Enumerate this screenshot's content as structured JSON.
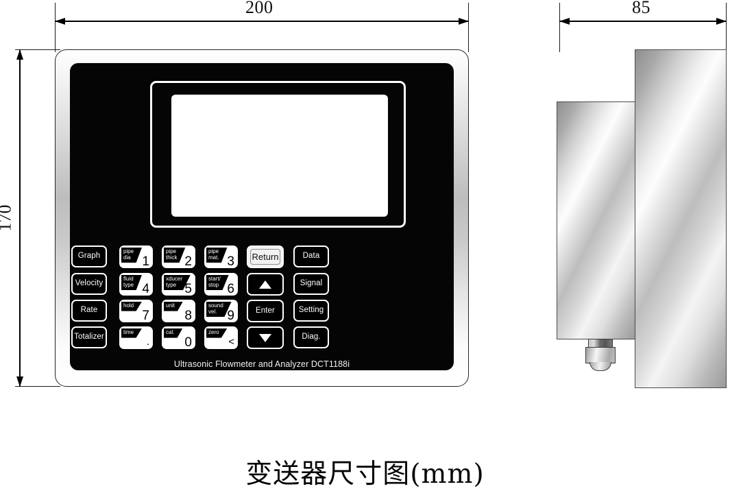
{
  "diagram": {
    "caption": "变送器尺寸图(mm)",
    "unit": "mm"
  },
  "dimensions": {
    "front_width": {
      "value": "200",
      "axis": "horizontal",
      "view": "front"
    },
    "front_height": {
      "value": "170",
      "axis": "vertical",
      "view": "front"
    },
    "side_depth": {
      "value": "85",
      "axis": "horizontal",
      "view": "side"
    }
  },
  "device": {
    "brand_text": "Ultrasonic Flowmeter and Analyzer DCT1188i",
    "model": "DCT1188i",
    "colors": {
      "faceplate": "#050505",
      "bezel_metal": "#c9c9c9",
      "screen": "#ffffff",
      "key_outline": "#ffffff"
    }
  },
  "keypad": {
    "function_keys_left": [
      {
        "label": "Graph"
      },
      {
        "label": "Velocity"
      },
      {
        "label": "Rate"
      },
      {
        "label": "Totalizer"
      }
    ],
    "numeric_keys": [
      {
        "tag1": "pipe",
        "tag2": "dia",
        "digit": "1"
      },
      {
        "tag1": "pipe",
        "tag2": "thick",
        "digit": "2"
      },
      {
        "tag1": "pipe",
        "tag2": "mat.",
        "digit": "3"
      },
      {
        "tag1": "fluid",
        "tag2": "type",
        "digit": "4"
      },
      {
        "tag1": "xducer",
        "tag2": "type",
        "digit": "5"
      },
      {
        "tag1": "start/",
        "tag2": "stop",
        "digit": "6"
      },
      {
        "tag1": "hold",
        "tag2": "",
        "digit": "7"
      },
      {
        "tag1": "unit",
        "tag2": "",
        "digit": "8"
      },
      {
        "tag1": "sound",
        "tag2": "vel.",
        "digit": "9"
      },
      {
        "tag1": "time",
        "tag2": "",
        "digit": "."
      },
      {
        "tag1": "cal.",
        "tag2": "",
        "digit": "0"
      },
      {
        "tag1": "zero",
        "tag2": "",
        "digit": "<"
      }
    ],
    "nav_keys": [
      {
        "label": "Return",
        "style": "light"
      },
      {
        "label": "▲",
        "style": "arrow-up"
      },
      {
        "label": "Enter",
        "style": "dark"
      },
      {
        "label": "▼",
        "style": "arrow-down"
      }
    ],
    "function_keys_right": [
      {
        "label": "Data"
      },
      {
        "label": "Signal"
      },
      {
        "label": "Setting"
      },
      {
        "label": "Diag."
      }
    ]
  }
}
